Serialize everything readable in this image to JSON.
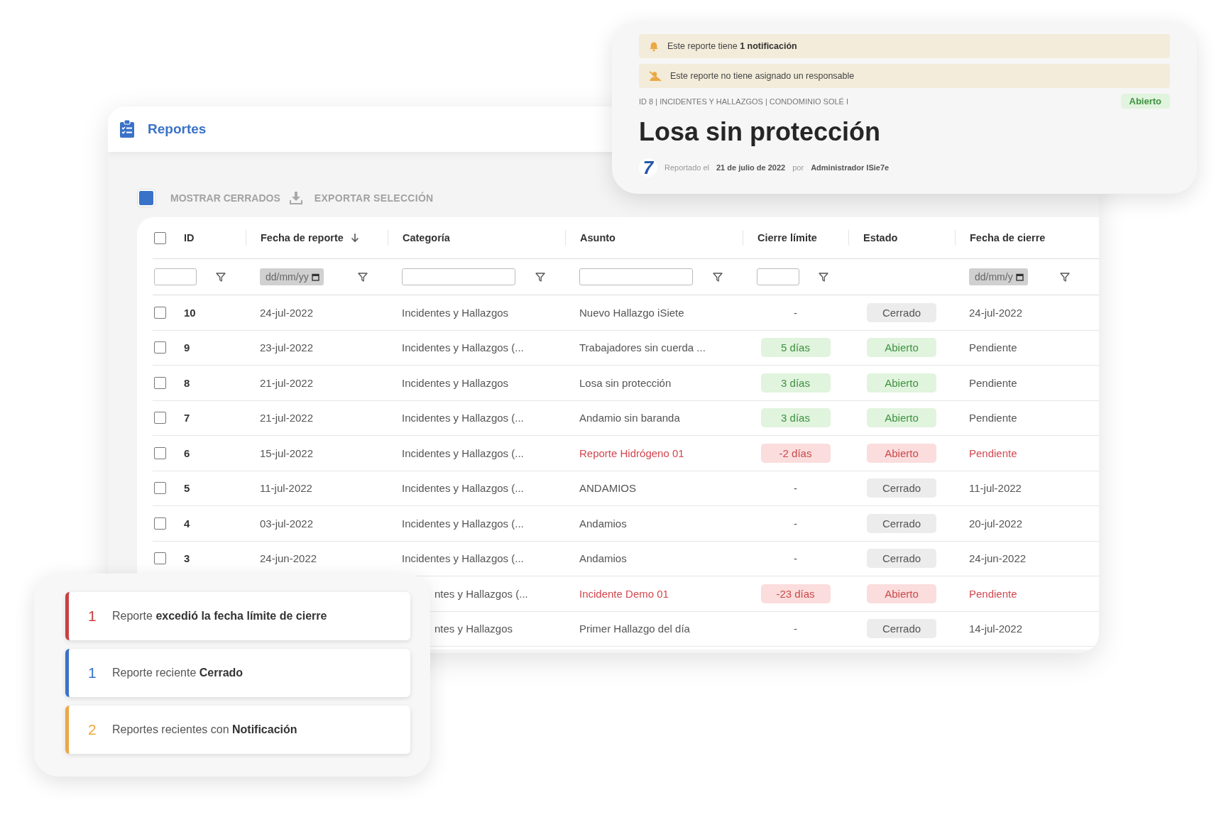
{
  "reports_window": {
    "title": "Reportes",
    "toolbar": {
      "show_closed": {
        "label": "MOSTRAR CERRADOS",
        "checked": true
      },
      "export": {
        "label": "EXPORTAR SELECCIÓN"
      }
    },
    "table": {
      "select_all": {
        "checked": false
      },
      "columns": [
        {
          "label": "ID",
          "sorted": false,
          "filter": {
            "kind": "text"
          }
        },
        {
          "label": "Fecha de reporte",
          "sorted": true,
          "filter": {
            "kind": "date",
            "placeholder": "dd/mm/yy"
          }
        },
        {
          "label": "Categoría",
          "sorted": false,
          "filter": {
            "kind": "text"
          }
        },
        {
          "label": "Asunto",
          "sorted": false,
          "filter": {
            "kind": "text"
          }
        },
        {
          "label": "Cierre límite",
          "sorted": false,
          "filter": {
            "kind": "text"
          }
        },
        {
          "label": "Estado",
          "sorted": false
        },
        {
          "label": "Fecha de cierre",
          "sorted": false,
          "filter": {
            "kind": "date",
            "placeholder": "dd/mm/y"
          }
        }
      ],
      "rows": [
        {
          "selected": false,
          "id": "10",
          "date": "24-jul-2022",
          "category": "Incidentes y Hallazgos",
          "subject": "Nuevo Hallazgo iSiete",
          "deadline": {
            "text": "-",
            "kind": "none"
          },
          "status": {
            "label": "Cerrado",
            "kind": "closed"
          },
          "overdue": false,
          "closed_on": "24-jul-2022"
        },
        {
          "selected": false,
          "id": "9",
          "date": "23-jul-2022",
          "category": "Incidentes y Hallazgos (...",
          "subject": "Trabajadores sin cuerda ...",
          "deadline": {
            "text": "5 días",
            "kind": "ok"
          },
          "status": {
            "label": "Abierto",
            "kind": "open"
          },
          "overdue": false,
          "closed_on": "Pendiente"
        },
        {
          "selected": false,
          "id": "8",
          "date": "21-jul-2022",
          "category": "Incidentes y Hallazgos",
          "subject": "Losa sin protección",
          "deadline": {
            "text": "3 días",
            "kind": "ok"
          },
          "status": {
            "label": "Abierto",
            "kind": "open"
          },
          "overdue": false,
          "closed_on": "Pendiente"
        },
        {
          "selected": false,
          "id": "7",
          "date": "21-jul-2022",
          "category": "Incidentes y Hallazgos (...",
          "subject": "Andamio sin baranda",
          "deadline": {
            "text": "3 días",
            "kind": "ok"
          },
          "status": {
            "label": "Abierto",
            "kind": "open"
          },
          "overdue": false,
          "closed_on": "Pendiente"
        },
        {
          "selected": false,
          "id": "6",
          "date": "15-jul-2022",
          "category": "Incidentes y Hallazgos (...",
          "subject": "Reporte Hidrógeno 01",
          "deadline": {
            "text": "-2 días",
            "kind": "late"
          },
          "status": {
            "label": "Abierto",
            "kind": "open"
          },
          "overdue": true,
          "closed_on": "Pendiente"
        },
        {
          "selected": false,
          "id": "5",
          "date": "11-jul-2022",
          "category": "Incidentes y Hallazgos (...",
          "subject": "ANDAMIOS",
          "deadline": {
            "text": "-",
            "kind": "none"
          },
          "status": {
            "label": "Cerrado",
            "kind": "closed"
          },
          "overdue": false,
          "closed_on": "11-jul-2022"
        },
        {
          "selected": false,
          "id": "4",
          "date": "03-jul-2022",
          "category": "Incidentes y Hallazgos (...",
          "subject": "Andamios",
          "deadline": {
            "text": "-",
            "kind": "none"
          },
          "status": {
            "label": "Cerrado",
            "kind": "closed"
          },
          "overdue": false,
          "closed_on": "20-jul-2022"
        },
        {
          "selected": false,
          "id": "3",
          "date": "24-jun-2022",
          "category": "Incidentes y Hallazgos (...",
          "subject": "Andamios",
          "deadline": {
            "text": "-",
            "kind": "none"
          },
          "status": {
            "label": "Cerrado",
            "kind": "closed"
          },
          "overdue": false,
          "closed_on": "24-jun-2022"
        },
        {
          "category": "ntes y Hallazgos (...",
          "subject": "Incidente Demo 01",
          "deadline": {
            "text": "-23 días",
            "kind": "late"
          },
          "status": {
            "label": "Abierto",
            "kind": "open"
          },
          "overdue": true,
          "closed_on": "Pendiente"
        },
        {
          "category": "ntes y Hallazgos",
          "subject": "Primer Hallazgo del día",
          "deadline": {
            "text": "-",
            "kind": "none"
          },
          "status": {
            "label": "Cerrado",
            "kind": "closed"
          },
          "overdue": false,
          "closed_on": "14-jul-2022"
        }
      ]
    }
  },
  "report_detail": {
    "notices": [
      {
        "kind": "notification",
        "text": "Este reporte tiene **1 notificación**"
      },
      {
        "kind": "unassigned",
        "text": "Este reporte no tiene asignado un responsable"
      }
    ],
    "breadcrumb": "ID 8 | INCIDENTES Y HALLAZGOS | CONDOMINIO SOLÉ I",
    "status": {
      "label": "Abierto",
      "kind": "open"
    },
    "title": "Losa sin protección",
    "logo": "7",
    "reported_label": "Reportado el",
    "reported_date": "21 de julio de 2022",
    "by_label": "por",
    "author": "Administrador ISie7e"
  },
  "summary": [
    {
      "count": "1",
      "text": "Reporte **excedió la fecha límite de cierre**",
      "color": "#c94040"
    },
    {
      "count": "1",
      "text": "Reporte reciente **Cerrado**",
      "color": "#3a72c8"
    },
    {
      "count": "2",
      "text": "Reportes recientes con **Notificación**",
      "color": "#eba843"
    }
  ]
}
